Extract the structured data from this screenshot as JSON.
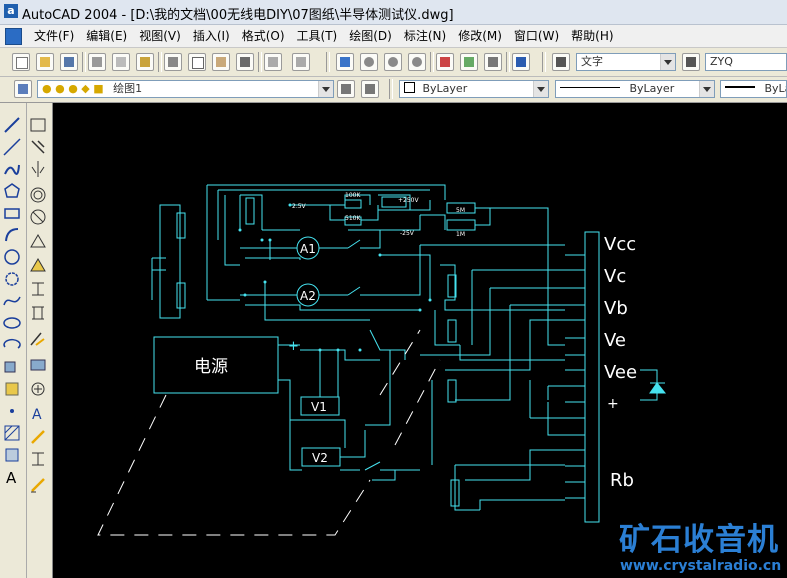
{
  "window": {
    "app_icon": "autocad-a-icon",
    "title": "AutoCAD 2004 - [D:\\我的文档\\00无线电DIY\\07图纸\\半导体测试仪.dwg]"
  },
  "menubar": {
    "items": [
      {
        "label": "文件(F)"
      },
      {
        "label": "编辑(E)"
      },
      {
        "label": "视图(V)"
      },
      {
        "label": "插入(I)"
      },
      {
        "label": "格式(O)"
      },
      {
        "label": "工具(T)"
      },
      {
        "label": "绘图(D)"
      },
      {
        "label": "标注(N)"
      },
      {
        "label": "修改(M)"
      },
      {
        "label": "窗口(W)"
      },
      {
        "label": "帮助(H)"
      }
    ]
  },
  "toolbar": {
    "text_style": "文字",
    "dim_style": "ZYQ"
  },
  "layers": {
    "current_layer": "绘图1",
    "color": "ByLayer",
    "linetype": "ByLayer",
    "lineweight": "ByLa"
  },
  "drawing": {
    "power_label": "电源",
    "plus_sign_power": "+",
    "meter_a1": "A1",
    "meter_a2": "A2",
    "meter_v1": "V1",
    "meter_v2": "V2",
    "terminal_labels": [
      "Vcc",
      "Vc",
      "Vb",
      "Ve",
      "Vee",
      "+",
      "Rb"
    ],
    "small_labels": [
      "2.5V",
      "100K",
      "+250V",
      "510K",
      "5M",
      "1M",
      "-25V"
    ]
  },
  "watermark": {
    "logo_text": "矿石收音机",
    "url": "www.crystalradio.cn"
  },
  "colors": {
    "canvas": "#000000",
    "wire": "#46e3f0",
    "text": "#ffffff",
    "watermark": "#2b7fd4"
  }
}
